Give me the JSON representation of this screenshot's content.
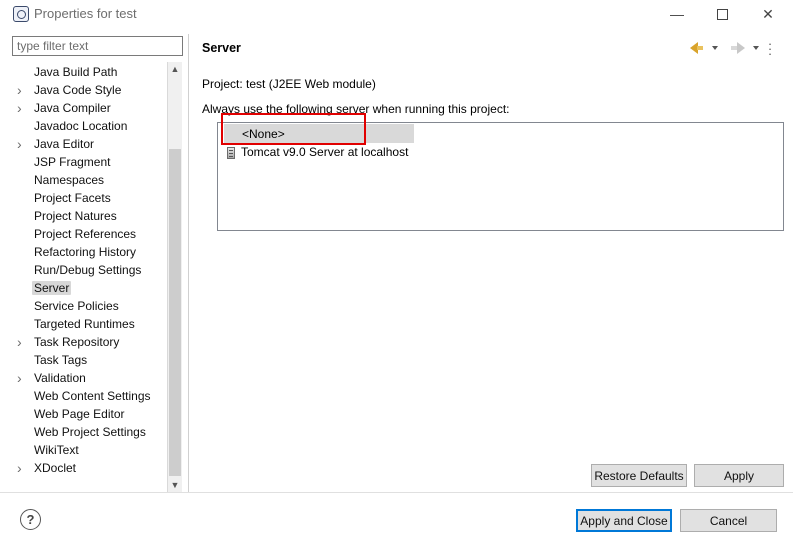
{
  "window": {
    "title": "Properties for test",
    "minimize_label": "—",
    "close_label": "✕"
  },
  "filter": {
    "placeholder": "type filter text",
    "value": ""
  },
  "tree": {
    "items": [
      {
        "label": "Java Build Path",
        "expandable": false
      },
      {
        "label": "Java Code Style",
        "expandable": true
      },
      {
        "label": "Java Compiler",
        "expandable": true
      },
      {
        "label": "Javadoc Location",
        "expandable": false
      },
      {
        "label": "Java Editor",
        "expandable": true
      },
      {
        "label": "JSP Fragment",
        "expandable": false
      },
      {
        "label": "Namespaces",
        "expandable": false
      },
      {
        "label": "Project Facets",
        "expandable": false
      },
      {
        "label": "Project Natures",
        "expandable": false
      },
      {
        "label": "Project References",
        "expandable": false
      },
      {
        "label": "Refactoring History",
        "expandable": false
      },
      {
        "label": "Run/Debug Settings",
        "expandable": false
      },
      {
        "label": "Server",
        "expandable": false,
        "selected": true
      },
      {
        "label": "Service Policies",
        "expandable": false
      },
      {
        "label": "Targeted Runtimes",
        "expandable": false
      },
      {
        "label": "Task Repository",
        "expandable": true
      },
      {
        "label": "Task Tags",
        "expandable": false
      },
      {
        "label": "Validation",
        "expandable": true
      },
      {
        "label": "Web Content Settings",
        "expandable": false
      },
      {
        "label": "Web Page Editor",
        "expandable": false
      },
      {
        "label": "Web Project Settings",
        "expandable": false
      },
      {
        "label": "WikiText",
        "expandable": false
      },
      {
        "label": "XDoclet",
        "expandable": true
      }
    ]
  },
  "page": {
    "title": "Server",
    "project_label": "Project: test (J2EE Web module)",
    "instruction": "Always use the following server when running this project:",
    "servers": [
      {
        "label": "<None>",
        "selected": true,
        "icon": "none"
      },
      {
        "label": "Tomcat v9.0 Server at localhost",
        "selected": false,
        "icon": "server-icon"
      }
    ]
  },
  "buttons": {
    "restore_defaults": "Restore Defaults",
    "apply": "Apply",
    "apply_and_close": "Apply and Close",
    "cancel": "Cancel",
    "help": "?"
  },
  "colors": {
    "highlight_box": "#e10000",
    "selection": "#d9d9d9",
    "default_button_border": "#0078d7",
    "back_arrow": "#d9a32b"
  }
}
